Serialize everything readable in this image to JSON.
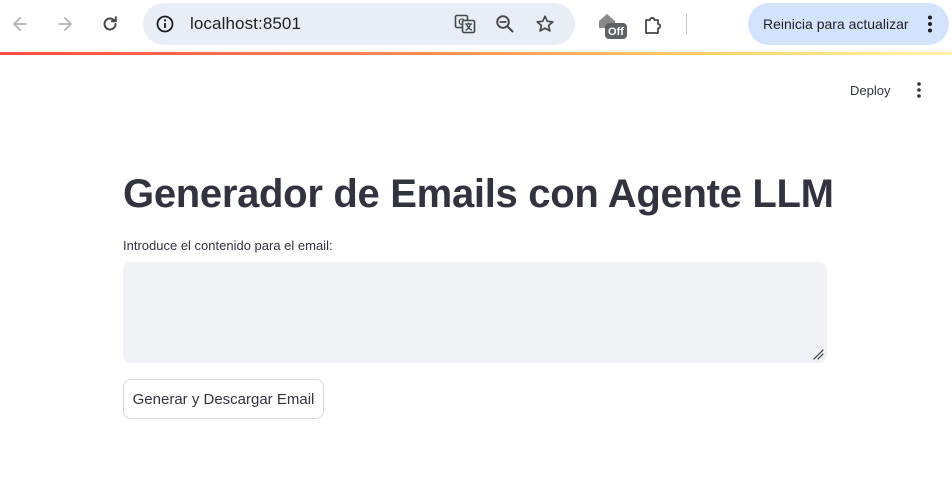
{
  "browser": {
    "url": "localhost:8501",
    "update_label": "Reinicia para actualizar",
    "extension_badge": "Off",
    "icons": {
      "back": "arrow-left-icon",
      "forward": "arrow-right-icon",
      "reload": "reload-icon",
      "site_info": "info-icon",
      "translate": "translate-icon",
      "zoom": "zoom-out-icon",
      "bookmark": "star-icon",
      "extension": "house-off-extension-icon",
      "extensions_menu": "puzzle-icon",
      "chrome_menu": "more-vert-icon"
    }
  },
  "header": {
    "deploy_label": "Deploy",
    "menu_icon": "more-vert-icon"
  },
  "main": {
    "title": "Generador de Emails con Agente LLM",
    "input_label": "Introduce el contenido para el email:",
    "input_value": "",
    "button_label": "Generar y Descargar Email"
  },
  "colors": {
    "text": "#31333f",
    "input_bg": "#f0f2f6",
    "omnibox_bg": "#e9eef6",
    "update_pill_bg": "#d3e3fd",
    "accent_gradient_start": "#ff4b4b",
    "accent_gradient_end": "#fff2b0"
  }
}
